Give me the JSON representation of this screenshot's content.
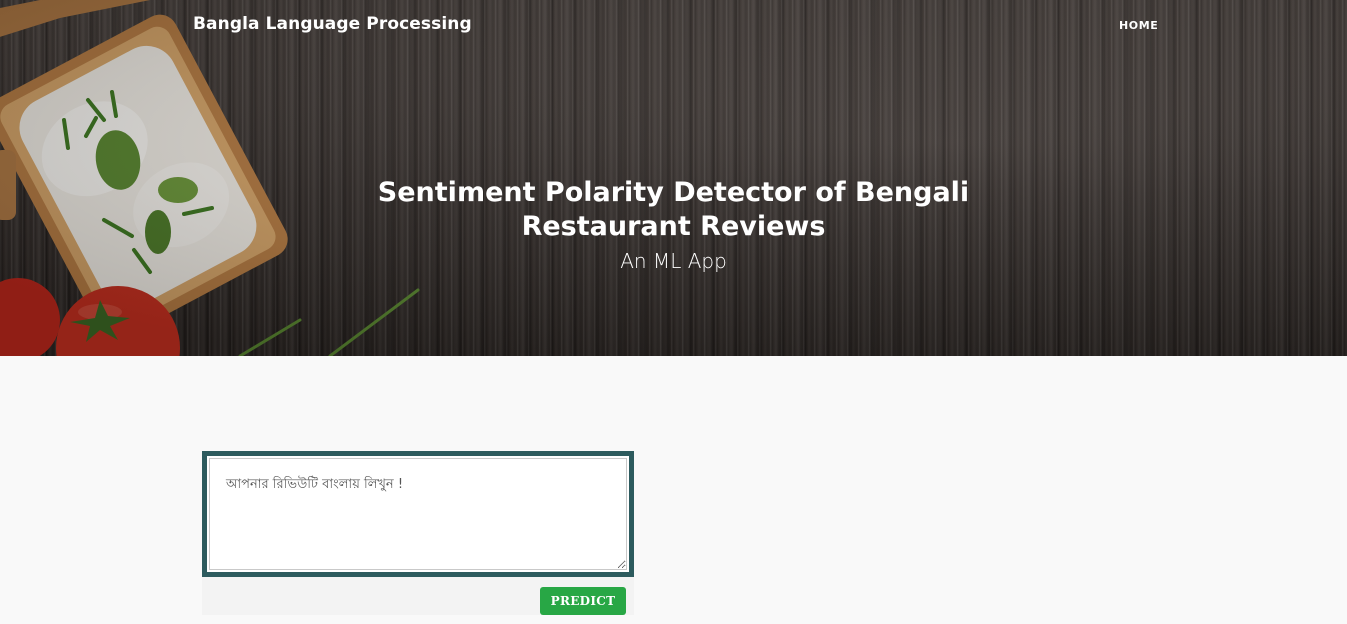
{
  "nav": {
    "brand": "Bangla Language Processing",
    "home": "HOME"
  },
  "hero": {
    "title": "Sentiment Polarity Detector of Bengali Restaurant Reviews",
    "subtitle": "An ML App"
  },
  "form": {
    "review_placeholder": "আপনার রিভিউটি বাংলায় লিখুন !",
    "review_value": "",
    "predict_label": "PREDICT"
  },
  "colors": {
    "border_accent": "#2d5b5e",
    "button": "#28a745"
  }
}
